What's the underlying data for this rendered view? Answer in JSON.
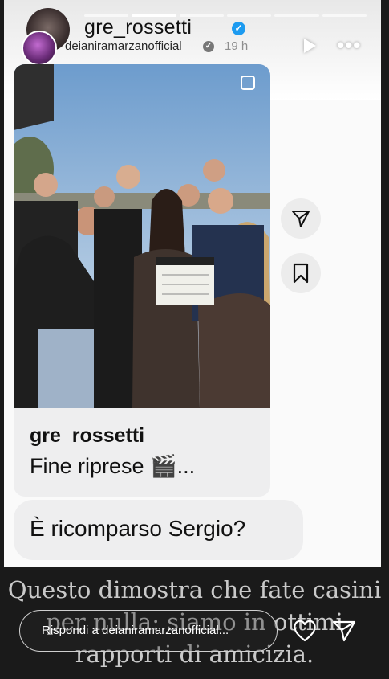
{
  "story": {
    "repost_username": "gre_rossetti",
    "poster_username": "deianiramarzanofficial",
    "time_ago": "19 h",
    "progress_segments": 6,
    "active_segment": 2
  },
  "post_card": {
    "username": "gre_rossetti",
    "caption": "Fine riprese 🎬..."
  },
  "reply_bubble": {
    "text": "È ricomparso Sergio?"
  },
  "overlay_text": {
    "line1": "Questo dimostra che fate casini",
    "line2": "per nulla: siamo in ottimi",
    "line3": "rapporti di amicizia."
  },
  "footer": {
    "reply_placeholder": "Rispondi a deianiramarzanofficial..."
  },
  "icons": {
    "play": "play-icon",
    "more": "more-icon",
    "share": "send-icon",
    "save": "bookmark-icon",
    "like": "heart-icon",
    "send": "send-icon"
  },
  "colors": {
    "verified": "#1d9bf0",
    "card_bg": "#eeeeef",
    "page_bg": "#1a1a1a"
  }
}
